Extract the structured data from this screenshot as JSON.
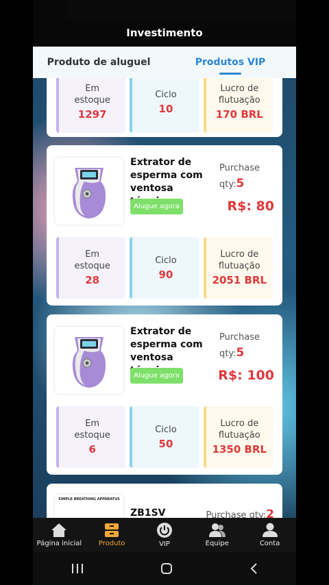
{
  "header": {
    "title": "Investimento"
  },
  "tabs": [
    {
      "label": "Produto de aluguel",
      "active": false
    },
    {
      "label": "Produtos VIP",
      "active": true
    }
  ],
  "partial_card": {
    "stats": [
      {
        "label1": "Em",
        "label2": "estoque",
        "value": "1297"
      },
      {
        "label1": "Ciclo",
        "label2": "",
        "value": "10"
      },
      {
        "label1": "Lucro de",
        "label2": "flutuação",
        "value": "170 BRL"
      }
    ]
  },
  "products": [
    {
      "name": "Extrator de esperma com ventosa térmica",
      "rent_label": "Alugue agora",
      "qty_label": "Purchase qty:",
      "qty": "5",
      "price": "R$: 80",
      "stats": [
        {
          "label1": "Em",
          "label2": "estoque",
          "value": "28"
        },
        {
          "label1": "Ciclo",
          "label2": "",
          "value": "90"
        },
        {
          "label1": "Lucro de",
          "label2": "flutuação",
          "value": "2051 BRL"
        }
      ]
    },
    {
      "name": "Extrator de esperma com ventosa térmica",
      "rent_label": "Alugue agora",
      "qty_label": "Purchase qty:",
      "qty": "5",
      "price": "R$: 100",
      "stats": [
        {
          "label1": "Em",
          "label2": "estoque",
          "value": "6"
        },
        {
          "label1": "Ciclo",
          "label2": "",
          "value": "50"
        },
        {
          "label1": "Lucro de",
          "label2": "flutuação",
          "value": "1350 BRL"
        }
      ]
    },
    {
      "name": "ZB1SV",
      "qty_label": "Purchase qty:",
      "qty": "2",
      "image_text": "SIMPLE BREATHING APPARATUS"
    }
  ],
  "nav": [
    {
      "label": "Página inicial",
      "icon": "home-icon",
      "active": false
    },
    {
      "label": "Produto",
      "icon": "product-icon",
      "active": true
    },
    {
      "label": "VIP",
      "icon": "power-icon",
      "active": false
    },
    {
      "label": "Equipe",
      "icon": "team-icon",
      "active": false
    },
    {
      "label": "Conta",
      "icon": "account-icon",
      "active": false
    }
  ],
  "colors": {
    "accent_blue": "#2a86d2",
    "price_red": "#e0383b",
    "rent_green": "#7ee06a",
    "nav_active": "#f3a73b"
  }
}
